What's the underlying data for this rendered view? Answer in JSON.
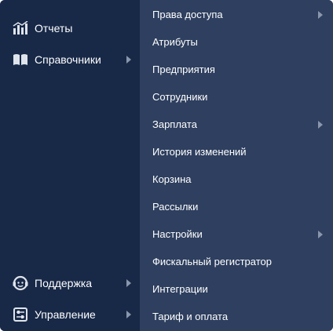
{
  "sidebar": {
    "items": [
      {
        "label": "Отчеты",
        "icon": "chart-icon"
      },
      {
        "label": "Справочники",
        "icon": "book-icon",
        "has_submenu": true
      },
      {
        "label": "Поддержка",
        "icon": "support-face-icon",
        "has_submenu": true
      },
      {
        "label": "Управление",
        "icon": "sliders-icon",
        "has_submenu": true
      }
    ]
  },
  "submenu": {
    "items": [
      {
        "label": "Права доступа",
        "has_submenu": true
      },
      {
        "label": "Атрибуты"
      },
      {
        "label": "Предприятия"
      },
      {
        "label": "Сотрудники"
      },
      {
        "label": "Зарплата",
        "has_submenu": true
      },
      {
        "label": "История изменений"
      },
      {
        "label": "Корзина"
      },
      {
        "label": "Рассылки"
      },
      {
        "label": "Настройки",
        "has_submenu": true
      },
      {
        "label": "Фискальный регистратор"
      },
      {
        "label": "Интеграции"
      },
      {
        "label": "Тариф и оплата"
      }
    ]
  },
  "colors": {
    "sidebar_bg": "#182948",
    "submenu_bg": "#2e3f5f",
    "text": "#ffffff",
    "chevron": "#8a96ab",
    "icon": "#dfe4ec"
  }
}
